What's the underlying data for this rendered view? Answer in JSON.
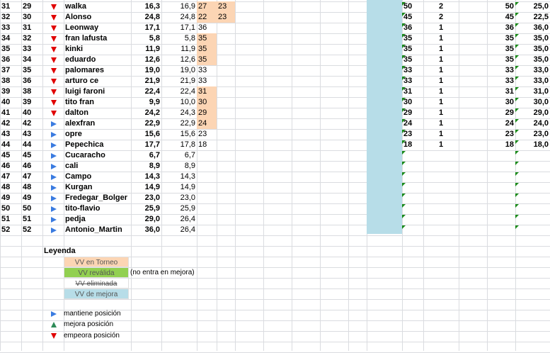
{
  "rows": [
    {
      "row": "31",
      "prev": "29",
      "trend": "down",
      "name": "walka",
      "avg": "16,3",
      "vv": "16,9",
      "torneo": "27",
      "t2": "23",
      "c": "50",
      "n": "2",
      "c2": "50",
      "v": "25,0"
    },
    {
      "row": "32",
      "prev": "30",
      "trend": "down",
      "name": "Alonso",
      "avg": "24,8",
      "vv": "24,8",
      "torneo": "22",
      "t2": "23",
      "c": "45",
      "n": "2",
      "c2": "45",
      "v": "22,5"
    },
    {
      "row": "33",
      "prev": "31",
      "trend": "down",
      "name": "Leonway",
      "avg": "17,1",
      "vv": "17,1",
      "torneo": "36",
      "t2": "",
      "c": "36",
      "n": "1",
      "c2": "36",
      "v": "36,0"
    },
    {
      "row": "34",
      "prev": "32",
      "trend": "down",
      "name": "fran lafusta",
      "avg": "5,8",
      "vv": "5,8",
      "torneo": "35",
      "t2": "",
      "c": "35",
      "n": "1",
      "c2": "35",
      "v": "35,0"
    },
    {
      "row": "35",
      "prev": "33",
      "trend": "down",
      "name": "kinki",
      "avg": "11,9",
      "vv": "11,9",
      "torneo": "35",
      "t2": "",
      "c": "35",
      "n": "1",
      "c2": "35",
      "v": "35,0"
    },
    {
      "row": "36",
      "prev": "34",
      "trend": "down",
      "name": "eduardo",
      "avg": "12,6",
      "vv": "12,6",
      "torneo": "35",
      "t2": "",
      "c": "35",
      "n": "1",
      "c2": "35",
      "v": "35,0"
    },
    {
      "row": "37",
      "prev": "35",
      "trend": "down",
      "name": "palomares",
      "avg": "19,0",
      "vv": "19,0",
      "torneo": "33",
      "t2": "",
      "c": "33",
      "n": "1",
      "c2": "33",
      "v": "33,0"
    },
    {
      "row": "38",
      "prev": "36",
      "trend": "down",
      "name": "arturo ce",
      "avg": "21,9",
      "vv": "21,9",
      "torneo": "33",
      "t2": "",
      "c": "33",
      "n": "1",
      "c2": "33",
      "v": "33,0"
    },
    {
      "row": "39",
      "prev": "38",
      "trend": "down",
      "name": "luigi faroni",
      "avg": "22,4",
      "vv": "22,4",
      "torneo": "31",
      "t2": "",
      "c": "31",
      "n": "1",
      "c2": "31",
      "v": "31,0"
    },
    {
      "row": "40",
      "prev": "39",
      "trend": "down",
      "name": "tito fran",
      "avg": "9,9",
      "vv": "10,0",
      "torneo": "30",
      "t2": "",
      "c": "30",
      "n": "1",
      "c2": "30",
      "v": "30,0"
    },
    {
      "row": "41",
      "prev": "40",
      "trend": "down",
      "name": "dalton",
      "avg": "24,2",
      "vv": "24,3",
      "torneo": "29",
      "t2": "",
      "c": "29",
      "n": "1",
      "c2": "29",
      "v": "29,0"
    },
    {
      "row": "42",
      "prev": "42",
      "trend": "same",
      "name": "alexfran",
      "avg": "22,9",
      "vv": "22,9",
      "torneo": "24",
      "t2": "",
      "c": "24",
      "n": "1",
      "c2": "24",
      "v": "24,0"
    },
    {
      "row": "43",
      "prev": "43",
      "trend": "same",
      "name": "opre",
      "avg": "15,6",
      "vv": "15,6",
      "torneo": "23",
      "t2": "",
      "c": "23",
      "n": "1",
      "c2": "23",
      "v": "23,0"
    },
    {
      "row": "44",
      "prev": "44",
      "trend": "same",
      "name": "Pepechica",
      "avg": "17,7",
      "vv": "17,8",
      "torneo": "18",
      "t2": "",
      "c": "18",
      "n": "1",
      "c2": "18",
      "v": "18,0"
    },
    {
      "row": "45",
      "prev": "45",
      "trend": "same",
      "name": "Cucaracho",
      "avg": "6,7",
      "vv": "6,7",
      "torneo": "",
      "t2": "",
      "c": "",
      "n": "",
      "c2": "",
      "v": ""
    },
    {
      "row": "46",
      "prev": "46",
      "trend": "same",
      "name": "cali",
      "avg": "8,9",
      "vv": "8,9",
      "torneo": "",
      "t2": "",
      "c": "",
      "n": "",
      "c2": "",
      "v": ""
    },
    {
      "row": "47",
      "prev": "47",
      "trend": "same",
      "name": "Campo",
      "avg": "14,3",
      "vv": "14,3",
      "torneo": "",
      "t2": "",
      "c": "",
      "n": "",
      "c2": "",
      "v": ""
    },
    {
      "row": "48",
      "prev": "48",
      "trend": "same",
      "name": "Kurgan",
      "avg": "14,9",
      "vv": "14,9",
      "torneo": "",
      "t2": "",
      "c": "",
      "n": "",
      "c2": "",
      "v": ""
    },
    {
      "row": "49",
      "prev": "49",
      "trend": "same",
      "name": "Fredegar_Bolger",
      "avg": "23,0",
      "vv": "23,0",
      "torneo": "",
      "t2": "",
      "c": "",
      "n": "",
      "c2": "",
      "v": ""
    },
    {
      "row": "50",
      "prev": "50",
      "trend": "same",
      "name": "tito-flavio",
      "avg": "25,9",
      "vv": "25,9",
      "torneo": "",
      "t2": "",
      "c": "",
      "n": "",
      "c2": "",
      "v": ""
    },
    {
      "row": "51",
      "prev": "51",
      "trend": "same",
      "name": "pedja",
      "avg": "29,0",
      "vv": "26,4",
      "torneo": "",
      "t2": "",
      "c": "",
      "n": "",
      "c2": "",
      "v": ""
    },
    {
      "row": "52",
      "prev": "52",
      "trend": "same",
      "name": "Antonio_Martin",
      "avg": "36,0",
      "vv": "26,4",
      "torneo": "",
      "t2": "",
      "c": "",
      "n": "",
      "c2": "",
      "v": ""
    }
  ],
  "legend": {
    "title": "Leyenda",
    "torneo": "VV en Torneo",
    "revalida": "VV reválida",
    "revalida_note": "(no entra en mejora)",
    "eliminada": "VV eliminada",
    "mejora": "VV de mejora",
    "mantiene": "mantiene posición",
    "mejora_pos": "mejora posición",
    "empeora": "empeora posición"
  },
  "colors": {
    "torneo": "#fcd5b4",
    "revalida": "#92d050",
    "mejora": "#b7dde8",
    "down": "#e00000",
    "same": "#3a7be0",
    "up": "#2e8b57",
    "flag": "#1a8a1a",
    "grid": "#dadce0"
  }
}
